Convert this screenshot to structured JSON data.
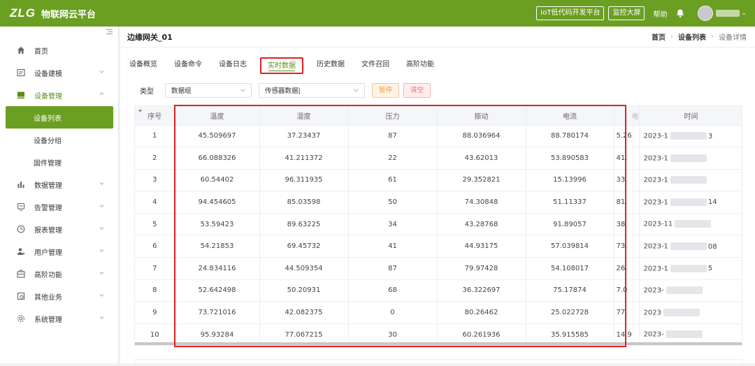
{
  "brand": {
    "logo": "ZLG",
    "title": "物联网云平台"
  },
  "topbar": {
    "buttons": [
      "IoT低代码开发平台",
      "监控大屏"
    ],
    "help": "帮助",
    "icons": {
      "bell": "bell-icon",
      "avatar": "avatar"
    }
  },
  "sidebar": {
    "items": [
      {
        "label": "首页",
        "icon": "home-icon"
      },
      {
        "label": "设备建模",
        "icon": "model-icon"
      },
      {
        "label": "设备管理",
        "icon": "device-icon"
      },
      {
        "label": "数据管理",
        "icon": "bar-chart-icon"
      },
      {
        "label": "告警管理",
        "icon": "alarm-icon"
      },
      {
        "label": "报表管理",
        "icon": "clock-icon"
      },
      {
        "label": "用户管理",
        "icon": "user-icon"
      },
      {
        "label": "高阶功能",
        "icon": "box-icon"
      },
      {
        "label": "其他业务",
        "icon": "doc-icon"
      },
      {
        "label": "系统管理",
        "icon": "gear-icon"
      }
    ],
    "subitems": [
      "设备列表",
      "设备分组",
      "固件管理"
    ]
  },
  "header": {
    "page_title": "边缘网关_01",
    "breadcrumb": [
      "首页",
      "设备列表",
      "设备详情"
    ]
  },
  "tabs": [
    "设备概览",
    "设备命令",
    "设备日志",
    "实时数据",
    "历史数据",
    "文件召回",
    "高阶功能"
  ],
  "filters": {
    "label": "类型",
    "select1": "数据组",
    "select2": "传感器数据|",
    "pause": "暂停",
    "clear": "清空"
  },
  "table": {
    "columns": [
      "序号",
      "温度",
      "湿度",
      "压力",
      "振动",
      "电流",
      "电",
      "时间"
    ],
    "rows": [
      {
        "idx": "1",
        "temp": "45.509697",
        "hum": "37.23437",
        "press": "87",
        "vib": "88.036964",
        "cur": "88.780174",
        "elec": "5.26",
        "time": "2023-1",
        "tail": "3"
      },
      {
        "idx": "2",
        "temp": "66.088326",
        "hum": "41.211372",
        "press": "22",
        "vib": "43.62013",
        "cur": "53.890583",
        "elec": "41.",
        "time": "2023-1",
        "tail": ""
      },
      {
        "idx": "3",
        "temp": "60.54402",
        "hum": "96.311935",
        "press": "61",
        "vib": "29.352821",
        "cur": "15.13996",
        "elec": "33.",
        "time": "2023-1",
        "tail": ""
      },
      {
        "idx": "4",
        "temp": "94.454605",
        "hum": "85.03598",
        "press": "50",
        "vib": "74.30848",
        "cur": "51.11337",
        "elec": "81.",
        "time": "2023-1",
        "tail": "14"
      },
      {
        "idx": "5",
        "temp": "53.59423",
        "hum": "89.63225",
        "press": "34",
        "vib": "43.28768",
        "cur": "91.89057",
        "elec": "38.",
        "time": "2023-11",
        "tail": ""
      },
      {
        "idx": "6",
        "temp": "54.21853",
        "hum": "69.45732",
        "press": "41",
        "vib": "44.93175",
        "cur": "57.039814",
        "elec": "73.",
        "time": "2023-1",
        "tail": "08"
      },
      {
        "idx": "7",
        "temp": "24.834116",
        "hum": "44.509354",
        "press": "87",
        "vib": "79.97428",
        "cur": "54.108017",
        "elec": "26.",
        "time": "2023-1",
        "tail": "5"
      },
      {
        "idx": "8",
        "temp": "52.642498",
        "hum": "50.20931",
        "press": "68",
        "vib": "36.322697",
        "cur": "75.17874",
        "elec": "7.0",
        "time": "2023-",
        "tail": ""
      },
      {
        "idx": "9",
        "temp": "73.721016",
        "hum": "42.082375",
        "press": "0",
        "vib": "80.26462",
        "cur": "25.022728",
        "elec": "77.",
        "time": "2023",
        "tail": ""
      },
      {
        "idx": "10",
        "temp": "95.93284",
        "hum": "77.067215",
        "press": "30",
        "vib": "60.261936",
        "cur": "35.915585",
        "elec": "14.9",
        "time": "2023-",
        "tail": ""
      }
    ]
  },
  "colors": {
    "brand_green": "#6a9f22",
    "highlight_red": "#e02020",
    "pause_orange": "#e6a23c",
    "clear_red": "#f56c6c"
  }
}
